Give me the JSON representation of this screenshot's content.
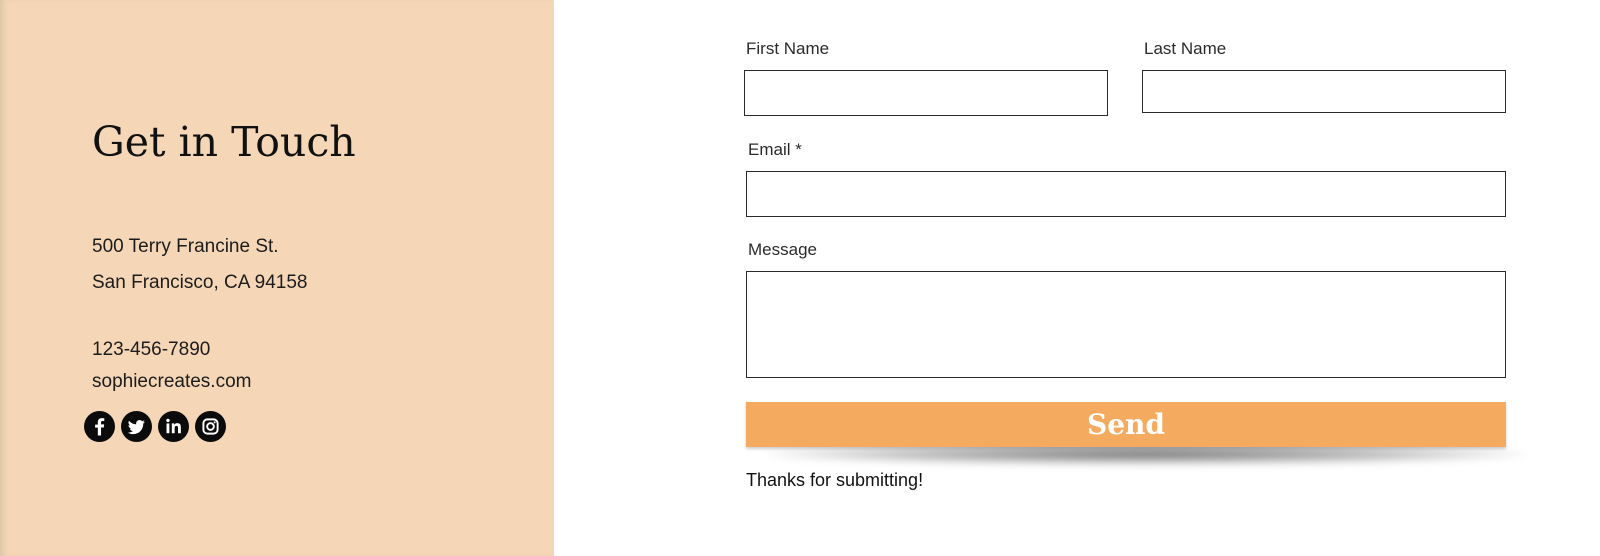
{
  "contact": {
    "heading": "Get in Touch",
    "address_line1": "500 Terry Francine St.",
    "address_line2": "San Francisco, CA 94158",
    "phone": "123-456-7890",
    "website": "sophiecreates.com",
    "social": [
      {
        "name": "facebook-icon"
      },
      {
        "name": "twitter-icon"
      },
      {
        "name": "linkedin-icon"
      },
      {
        "name": "instagram-icon"
      }
    ]
  },
  "form": {
    "first_name_label": "First Name",
    "first_name_value": "",
    "last_name_label": "Last Name",
    "last_name_value": "",
    "email_label": "Email *",
    "email_value": "",
    "message_label": "Message",
    "message_value": "",
    "send_label": "Send",
    "success_message": "Thanks for submitting!"
  },
  "colors": {
    "panel_background": "#f5d7b7",
    "button_background": "#f4ab60",
    "button_text": "#ffffff",
    "social_icon": "#0b0b0b"
  }
}
